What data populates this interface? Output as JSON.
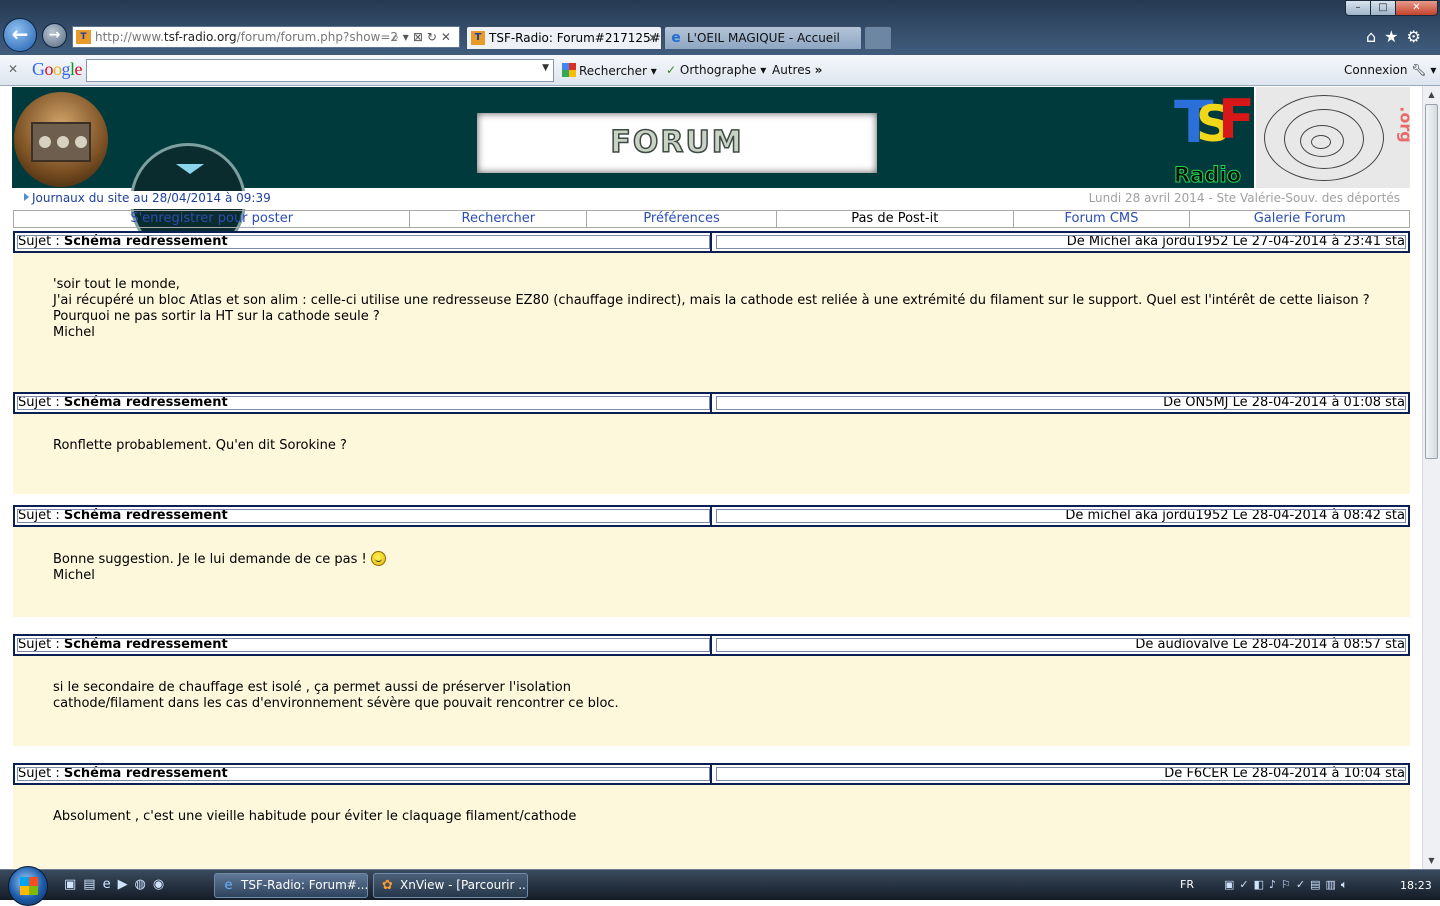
{
  "browser": {
    "address": {
      "prefix": "http://www.",
      "domain": "tsf-radio.org",
      "path": "/forum/forum.php?show=2",
      "tools": "⌕▾⊠↻✕"
    },
    "tabs": [
      {
        "label": "TSF-Radio: Forum#217125#..."
      },
      {
        "label": "L'OEIL MAGIQUE - Accueil"
      }
    ],
    "window_controls": {
      "min": "–",
      "max": "□",
      "close": "✕"
    },
    "right_icons": "⌂★⚙"
  },
  "google_toolbar": {
    "close": "✕",
    "logo": [
      "G",
      "o",
      "o",
      "g",
      "l",
      "e"
    ],
    "logo_colors": [
      "#3369e8",
      "#d50f25",
      "#eeb211",
      "#3369e8",
      "#009925",
      "#d50f25"
    ],
    "search_label": "Rechercher",
    "spell_label": "Orthographe",
    "other_label": "Autres",
    "login_label": "Connexion"
  },
  "site": {
    "forum_title": "FORUM",
    "logo": {
      "t": "T",
      "s": "S",
      "f": "F",
      "radio": "Radio",
      "org": ".org"
    },
    "journal_link": "Journaux du site au 28/04/2014 à 09:39",
    "date_text": "Lundi 28 avril 2014 - Ste Valérie-Souv. des déportés",
    "menu": [
      {
        "label": "S'enregistrer pour poster",
        "link": true
      },
      {
        "label": "Rechercher",
        "link": true
      },
      {
        "label": "Préférences",
        "link": true
      },
      {
        "label": "Pas de Post-it",
        "link": false
      },
      {
        "label": "Forum CMS",
        "link": true
      },
      {
        "label": "Galerie Forum",
        "link": true
      }
    ]
  },
  "posts": [
    {
      "subject_prefix": "Sujet : ",
      "subject": "Schéma redressement",
      "author_line": "De Michel aka jordu1952  Le 27-04-2014 à 23:41 sta",
      "body": "'soir tout le monde,\nJ'ai récupéré un bloc Atlas et son alim : celle-ci utilise une redresseuse EZ80 (chauffage indirect), mais la cathode est reliée à une extrémité du filament sur le support. Quel est l'intérêt de cette liaison ?\nPourquoi ne pas sortir la HT sur la cathode seule ?\nMichel"
    },
    {
      "subject_prefix": "Sujet : ",
      "subject": "Schéma redressement",
      "author_line": "De ON5MJ  Le 28-04-2014 à 01:08 sta",
      "body": "Ronflette probablement. Qu'en dit Sorokine ?"
    },
    {
      "subject_prefix": "Sujet : ",
      "subject": "Schéma redressement",
      "author_line": "De michel aka jordu1952  Le 28-04-2014 à 08:42 sta",
      "body_line1": "Bonne suggestion. Je le lui demande de ce pas !",
      "body_line2": "Michel"
    },
    {
      "subject_prefix": "Sujet : ",
      "subject": "Schéma redressement",
      "author_line": "De audiovalve  Le 28-04-2014 à 08:57 sta",
      "body": "si le secondaire de chauffage est isolé , ça permet aussi de préserver l'isolation\ncathode/filament dans les cas d'environnement sévère que pouvait rencontrer ce bloc."
    },
    {
      "subject_prefix": "Sujet : ",
      "subject": "Schéma redressement",
      "author_line": "De F6CER  Le 28-04-2014 à 10:04 sta",
      "body": "Absolument , c'est une vieille habitude pour éviter le claquage filament/cathode"
    }
  ],
  "taskbar": {
    "tasks": [
      {
        "label": "TSF-Radio: Forum#..."
      },
      {
        "label": "XnView - [Parcourir ..."
      }
    ],
    "lang": "FR",
    "clock": "18:23",
    "quick": "▣▤e▶◍◉"
  }
}
